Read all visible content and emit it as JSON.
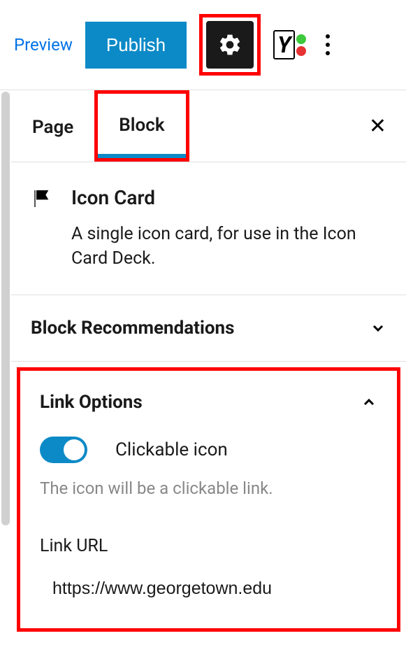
{
  "toolbar": {
    "preview_label": "Preview",
    "publish_label": "Publish"
  },
  "tabs": {
    "page_label": "Page",
    "block_label": "Block"
  },
  "block": {
    "title": "Icon Card",
    "description": "A single icon card, for use in the Icon Card Deck."
  },
  "sections": {
    "recommendations_title": "Block Recommendations",
    "link_options_title": "Link Options"
  },
  "link_options": {
    "toggle_label": "Clickable icon",
    "toggle_help": "The icon will be a clickable link.",
    "url_label": "Link URL",
    "url_value": "https://www.georgetown.edu"
  }
}
